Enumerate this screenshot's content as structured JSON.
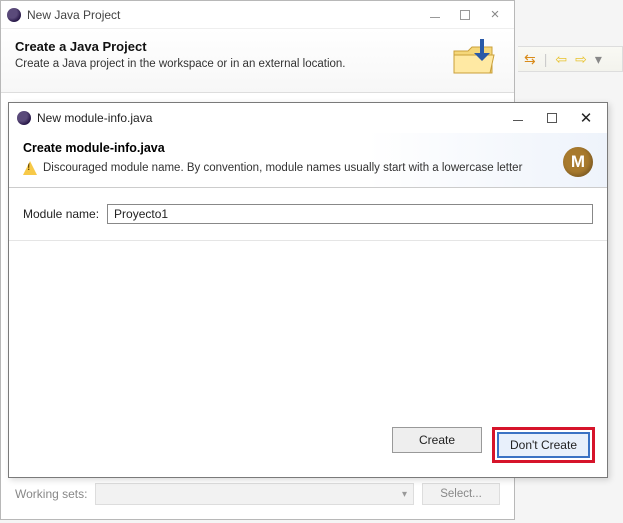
{
  "back_window": {
    "title": "New Java Project",
    "heading": "Create a Java Project",
    "subtext": "Create a Java project in the workspace or in an external location.",
    "working_sets_label": "Working sets:",
    "select_btn": "Select..."
  },
  "dialog": {
    "title": "New module-info.java",
    "heading": "Create module-info.java",
    "warning": "Discouraged module name. By convention, module names usually start with a lowercase letter",
    "badge": "M",
    "module_name_label": "Module name:",
    "module_name_value": "Proyecto1",
    "buttons": {
      "create": "Create",
      "dont_create": "Don't Create"
    }
  }
}
